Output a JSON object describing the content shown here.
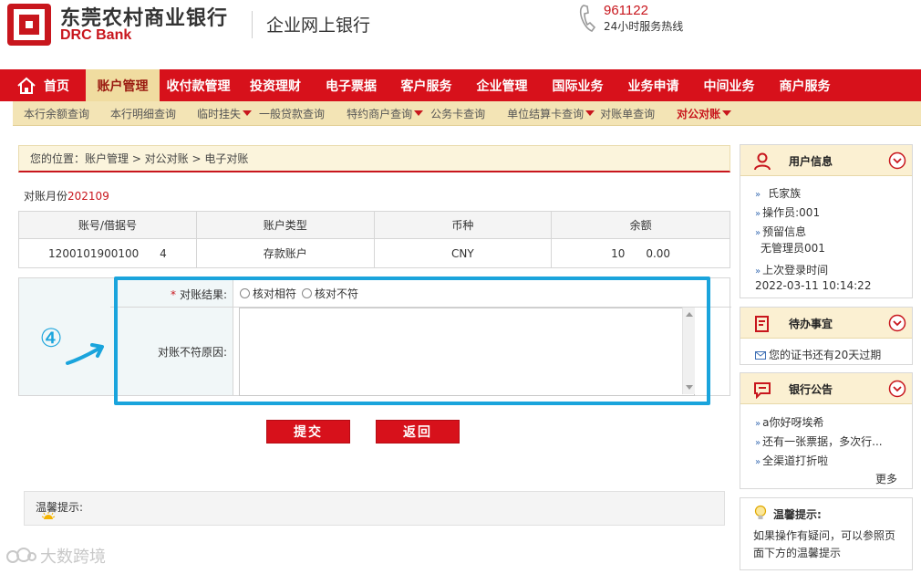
{
  "header": {
    "bank_name_cn": "东莞农村商业银行",
    "bank_name_en": "DRC Bank",
    "product_title": "企业网上银行",
    "hotline_number": "961122",
    "hotline_label": "24小时服务热线"
  },
  "nav": {
    "home_label": "首页",
    "items": [
      "账户管理",
      "收付款管理",
      "投资理财",
      "电子票据",
      "客户服务",
      "企业管理",
      "国际业务",
      "业务申请",
      "中间业务",
      "商户服务"
    ],
    "active": "账户管理"
  },
  "subnav": {
    "items": [
      "本行余额查询",
      "本行明细查询",
      "临时挂失",
      "一般贷款查询",
      "特约商户查询",
      "公务卡查询",
      "单位结算卡查询",
      "对账单查询",
      "对公对账"
    ],
    "with_dropdown": [
      "临时挂失",
      "特约商户查询",
      "单位结算卡查询",
      "对公对账"
    ],
    "active": "对公对账"
  },
  "breadcrumb": "您的位置：账户管理 > 对公对账 > 电子对账",
  "statement_month": {
    "label": "对账月份",
    "value": "202109"
  },
  "account_table": {
    "headers": [
      "账号/借据号",
      "账户类型",
      "币种",
      "余额"
    ],
    "rows": [
      {
        "account": "1200101900100      4",
        "type": "存款账户",
        "currency": "CNY",
        "balance": "10      0.00"
      }
    ]
  },
  "form": {
    "result_label": "对账结果:",
    "result_options": [
      "核对相符",
      "核对不符"
    ],
    "reason_label": "对账不符原因:",
    "reason_value": ""
  },
  "annotation": {
    "step": "④",
    "color": "#1aa4dc"
  },
  "buttons": {
    "submit": "提交",
    "back": "返回"
  },
  "tips": {
    "title": "温馨提示:"
  },
  "watermark": "大数跨境",
  "sidebar": {
    "user_info": {
      "title": "用户信息",
      "name": "氏家族",
      "operator": "操作员:001",
      "reserved_info_label": "预留信息",
      "reserved_info_value": "无管理员001",
      "last_login_label": "上次登录时间",
      "last_login_time": "2022-03-11 10:14:22"
    },
    "todo": {
      "title": "待办事宜",
      "item": "您的证书还有20天过期"
    },
    "announcements": {
      "title": "银行公告",
      "items": [
        "a你好呀埃希",
        "还有一张票据，多次行...",
        "全渠道打折啦"
      ],
      "more": "更多"
    },
    "warm_tips": {
      "title": "温馨提示:",
      "text_line1": "如果操作有疑问，可以参照页",
      "text_line2": "面下方的温馨提示"
    }
  },
  "colors": {
    "brand_red": "#d7111b",
    "nav_active_bg": "#f0dca0",
    "subnav_bg": "#f3e4b5",
    "annotation_blue": "#1aa4dc"
  }
}
